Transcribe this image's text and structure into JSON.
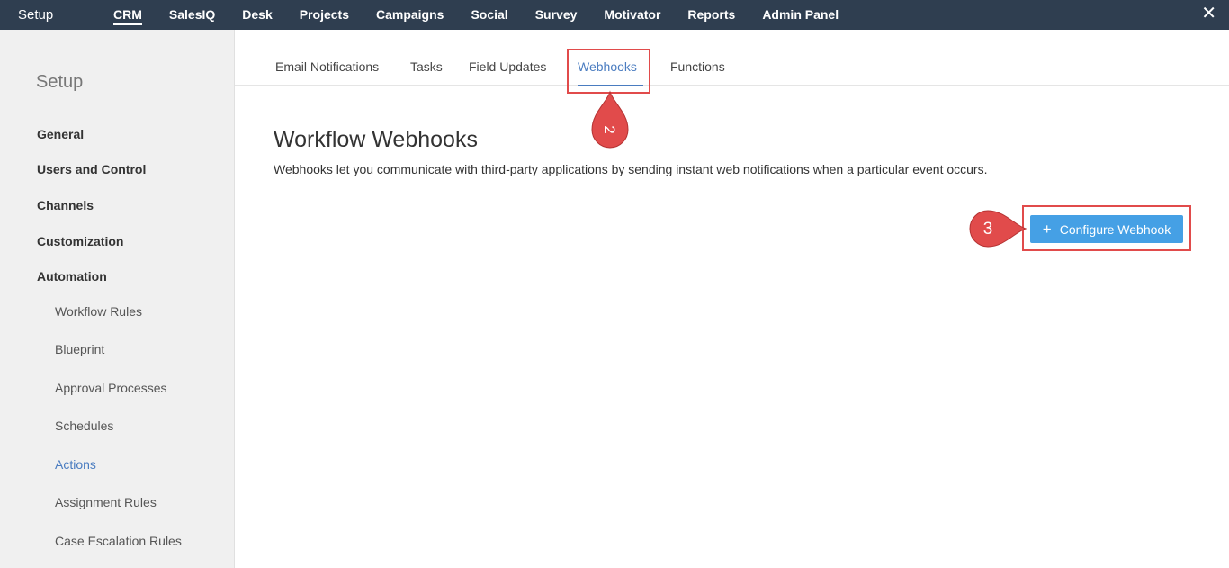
{
  "topbar": {
    "setup_label": "Setup",
    "nav": [
      "CRM",
      "SalesIQ",
      "Desk",
      "Projects",
      "Campaigns",
      "Social",
      "Survey",
      "Motivator",
      "Reports",
      "Admin Panel"
    ],
    "active_nav": "CRM",
    "close_icon": "close-icon"
  },
  "sidebar": {
    "title": "Setup",
    "sections": [
      "General",
      "Users and Control",
      "Channels",
      "Customization",
      "Automation"
    ],
    "automation_items": [
      "Workflow Rules",
      "Blueprint",
      "Approval Processes",
      "Schedules",
      "Actions",
      "Assignment Rules",
      "Case Escalation Rules"
    ],
    "active_item": "Actions"
  },
  "tabs": {
    "items": [
      "Email Notifications",
      "Tasks",
      "Field Updates",
      "Webhooks",
      "Functions"
    ],
    "active": "Webhooks"
  },
  "main": {
    "title": "Workflow Webhooks",
    "description": "Webhooks let you communicate with third-party applications by sending instant web notifications when a particular event occurs.",
    "configure_button": "Configure Webhook",
    "button_icon": "plus-icon"
  },
  "annotations": {
    "step_2": "2",
    "step_3": "3",
    "color": "#e14b4b"
  },
  "colors": {
    "topbar_bg": "#2f3e50",
    "accent": "#4a7cc0",
    "button_bg": "#45a0e5"
  }
}
